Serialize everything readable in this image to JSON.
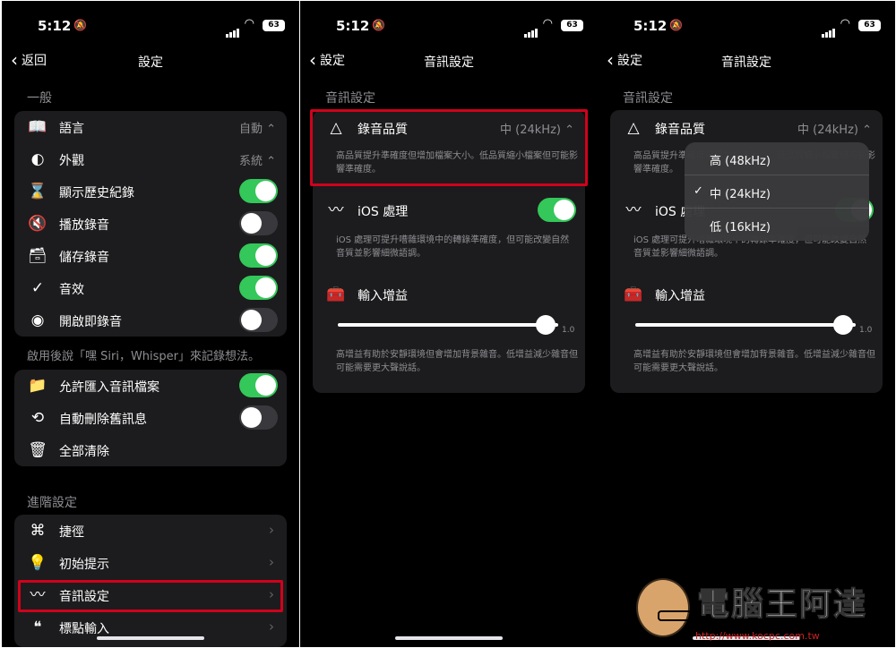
{
  "status": {
    "time": "5:12",
    "battery": "63"
  },
  "screen1": {
    "back_label": "返回",
    "title": "設定",
    "section_general": "一般",
    "rows_a": [
      {
        "icon": "book-icon",
        "glyph": "📖",
        "label": "語言",
        "value": "自動 ⌃",
        "toggle": null
      },
      {
        "icon": "half-circle-icon",
        "glyph": "◐",
        "label": "外觀",
        "value": "系統 ⌃",
        "toggle": null
      },
      {
        "icon": "hourglass-icon",
        "glyph": "⌛",
        "label": "顯示歷史紀錄",
        "value": null,
        "toggle": true
      },
      {
        "icon": "speaker-off-icon",
        "glyph": "🔇",
        "label": "播放錄音",
        "value": null,
        "toggle": false
      },
      {
        "icon": "archive-icon",
        "glyph": "🗃",
        "label": "儲存錄音",
        "value": null,
        "toggle": true
      },
      {
        "icon": "checkmark-icon",
        "glyph": "✓",
        "label": "音效",
        "value": null,
        "toggle": true
      },
      {
        "icon": "record-icon",
        "glyph": "◉",
        "label": "開啟即錄音",
        "value": null,
        "toggle": false
      }
    ],
    "siri_note": "啟用後說「嘿 Siri，Whisper」來記錄想法。",
    "rows_b": [
      {
        "icon": "folder-add-icon",
        "glyph": "📁",
        "label": "允許匯入音訊檔案",
        "toggle": true
      },
      {
        "icon": "history-icon",
        "glyph": "⟲",
        "label": "自動刪除舊訊息",
        "toggle": false
      },
      {
        "icon": "trash-icon",
        "glyph": "🗑",
        "label": "全部清除",
        "toggle": null
      }
    ],
    "section_advanced": "進階設定",
    "rows_c": [
      {
        "icon": "command-icon",
        "glyph": "⌘",
        "label": "捷徑"
      },
      {
        "icon": "lightbulb-icon",
        "glyph": "💡",
        "label": "初始提示"
      },
      {
        "icon": "waveform-icon",
        "glyph": "〰",
        "label": "音訊設定"
      },
      {
        "icon": "quote-icon",
        "glyph": "❝",
        "label": "標點輸入"
      }
    ]
  },
  "screen2": {
    "back_label": "設定",
    "title": "音訊設定",
    "section": "音訊設定",
    "quality_label": "錄音品質",
    "quality_value": "中 (24kHz) ⌃",
    "quality_desc": "高品質提升準確度但增加檔案大小。低品質縮小檔案但可能影響準確度。",
    "ios_label": "iOS 處理",
    "ios_toggle": true,
    "ios_desc": "iOS 處理可提升嘈雜環境中的轉錄準確度，但可能改變自然音質並影響細微語調。",
    "gain_label": "輸入增益",
    "gain_value": 1.0,
    "gain_text": "1.0",
    "gain_desc": "高增益有助於安靜環境但會增加背景雜音。低增益減少雜音但可能需要更大聲說話。"
  },
  "screen3": {
    "back_label": "設定",
    "title": "音訊設定",
    "section": "音訊設定",
    "quality_label": "錄音品質",
    "quality_value": "中 (24kHz) ⌃",
    "quality_desc": "高品質提升準確度但增加檔案大小。低品質縮小檔案但可能影響準確度。",
    "ios_label": "iOS 處理",
    "ios_desc": "iOS 處理可提升嘈雜環境中的轉錄準確度，但可能改變自然音質並影響細微語調。",
    "gain_label": "輸入增益",
    "gain_text": "1.0",
    "gain_desc": "高增益有助於安靜環境但會增加背景雜音。低增益減少雜音但可能需要更大聲說話。",
    "menu_options": [
      {
        "label": "高 (48kHz)",
        "selected": false
      },
      {
        "label": "中 (24kHz)",
        "selected": true
      },
      {
        "label": "低 (16kHz)",
        "selected": false
      }
    ],
    "check_mark": "✓"
  },
  "watermark": {
    "text": "電腦王阿達",
    "url": "http://www.kocpc.com.tw"
  },
  "colors": {
    "toggle_on": "#34c759",
    "highlight": "#d0021b",
    "card": "#1c1c1e"
  }
}
